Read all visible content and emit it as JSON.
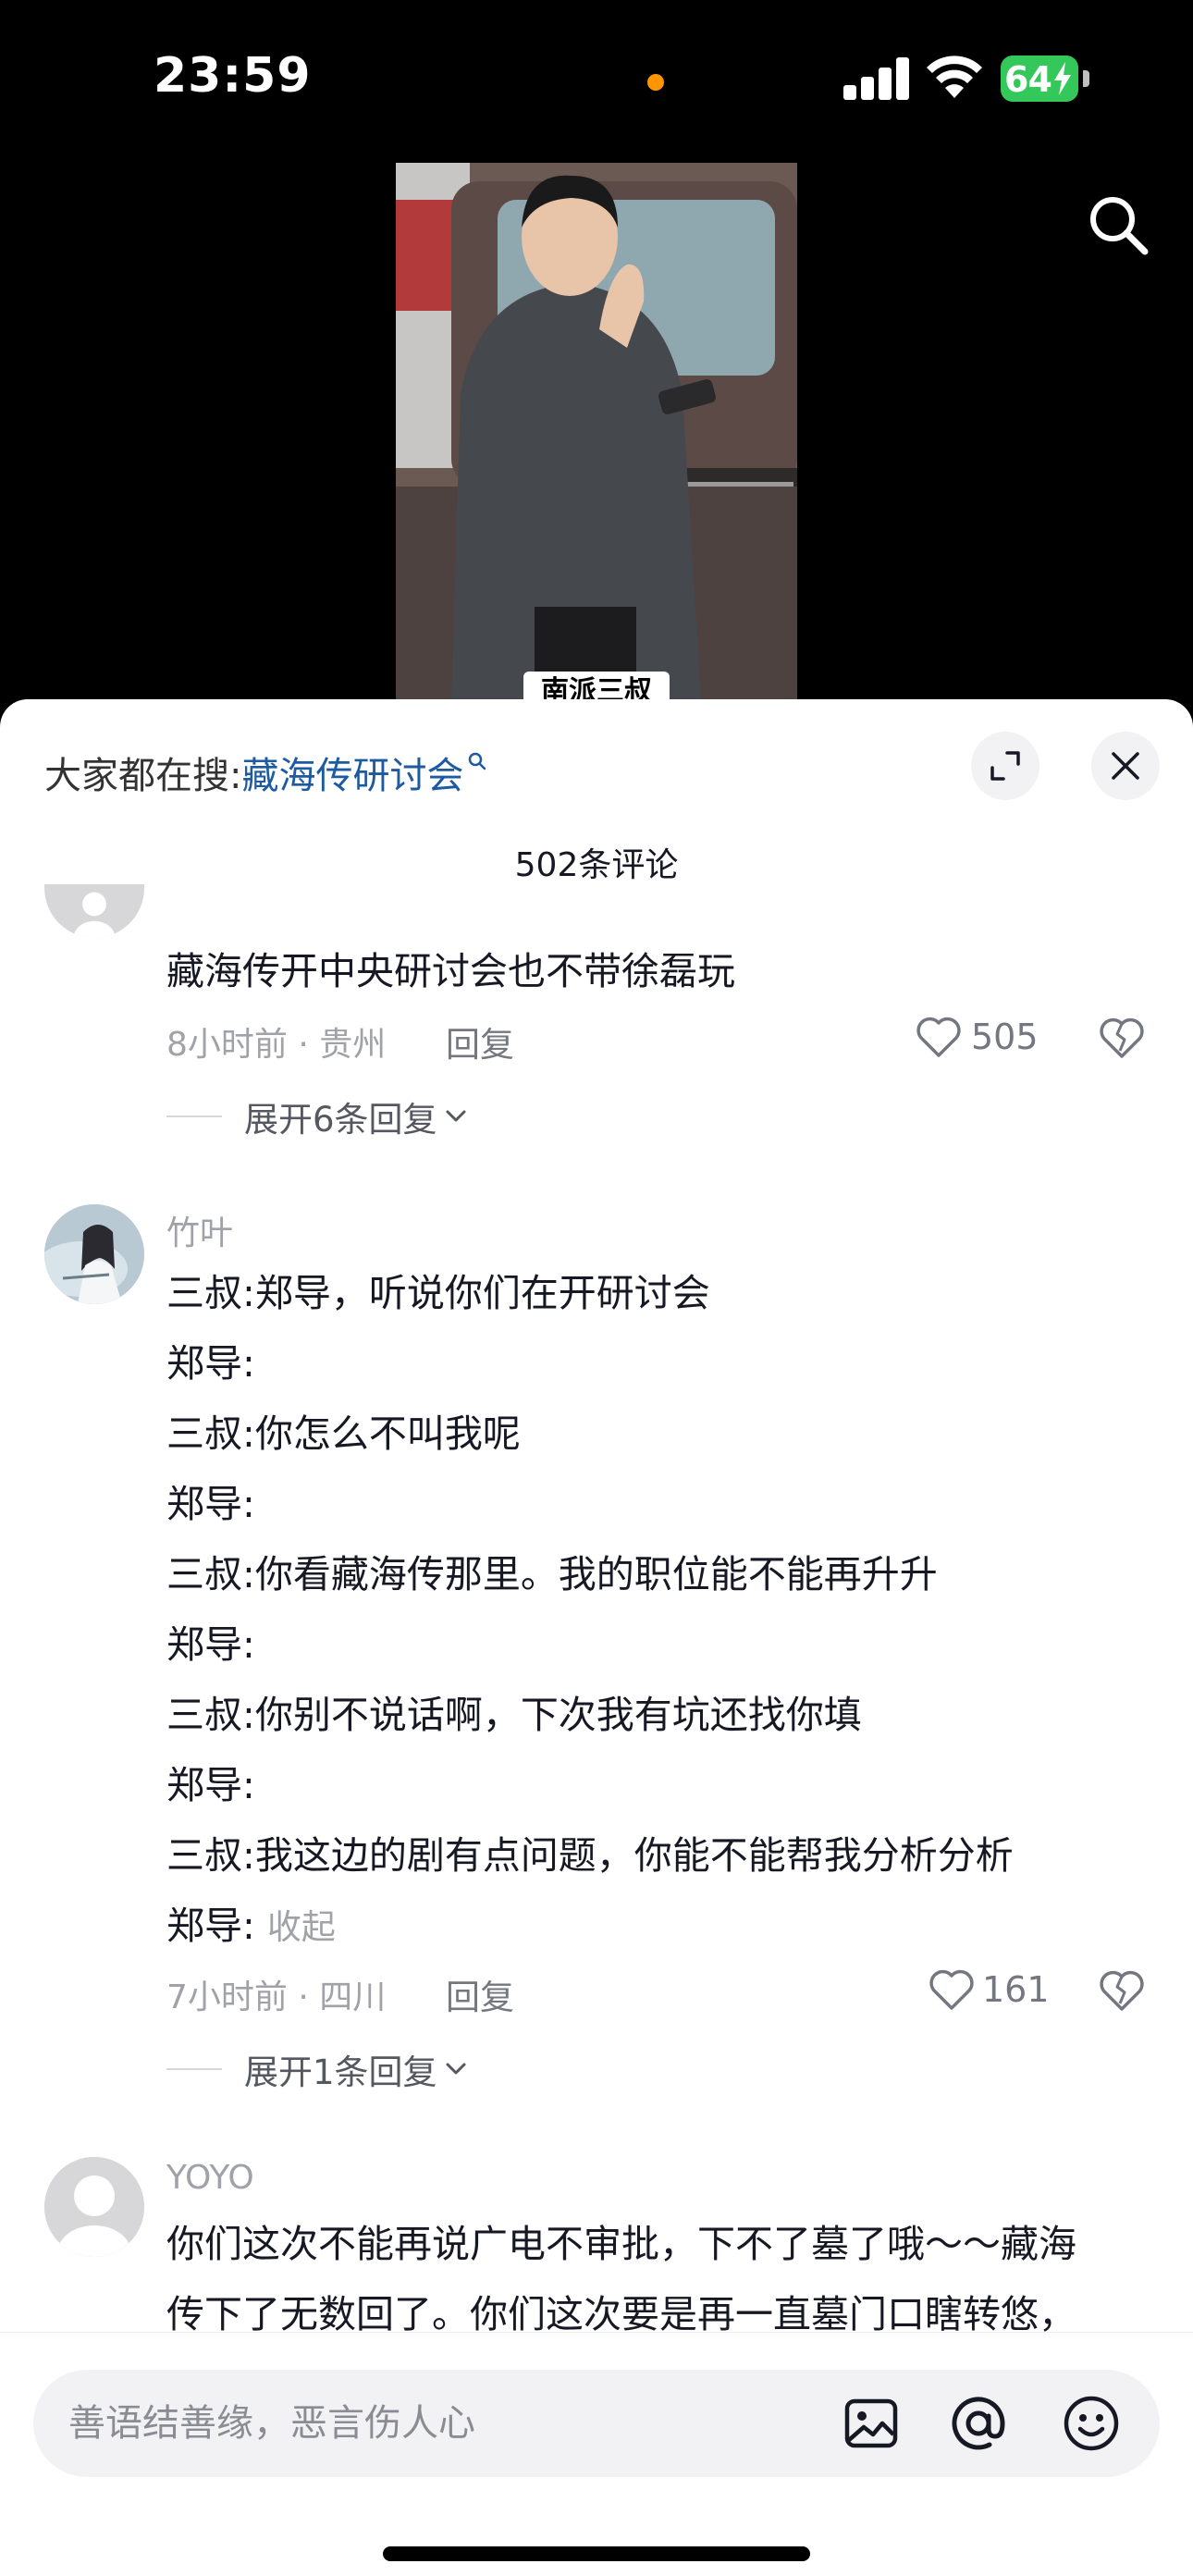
{
  "status_bar": {
    "time": "23:59",
    "battery": "64"
  },
  "video": {
    "caption": "南派三叔"
  },
  "sheet": {
    "search_prefix": "大家都在搜:",
    "search_keyword": "藏海传研讨会",
    "comment_count": "502条评论"
  },
  "comments": [
    {
      "username": "",
      "lines": [
        "藏海传开中央研讨会也不带徐磊玩"
      ],
      "time_location": "8小时前 · 贵州",
      "reply_label": "回复",
      "likes": "505",
      "expand_replies": "展开6条回复"
    },
    {
      "username": "竹叶",
      "lines": [
        "三叔:郑导，听说你们在开研讨会",
        "郑导:",
        "三叔:你怎么不叫我呢",
        "郑导:",
        "三叔:你看藏海传那里。我的职位能不能再升升",
        "郑导:",
        "三叔:你别不说话啊，下次我有坑还找你填",
        "郑导:",
        "三叔:我这边的剧有点问题，你能不能帮我分析分析",
        "郑导:"
      ],
      "collapse_label": "收起",
      "time_location": "7小时前 · 四川",
      "reply_label": "回复",
      "likes": "161",
      "expand_replies": "展开1条回复"
    },
    {
      "username": "YOYO",
      "lines": [
        "你们这次不能再说广电不审批，下不了墓了哦～～藏海",
        "传下了无数回了。你们这次要是再一直墓门口瞎转悠，"
      ]
    }
  ],
  "input_bar": {
    "placeholder": "善语结善缘，恶言伤人心"
  },
  "colors": {
    "keyword": "#1e5aa0",
    "battery": "#34c759",
    "status_dot": "#ff9500"
  }
}
